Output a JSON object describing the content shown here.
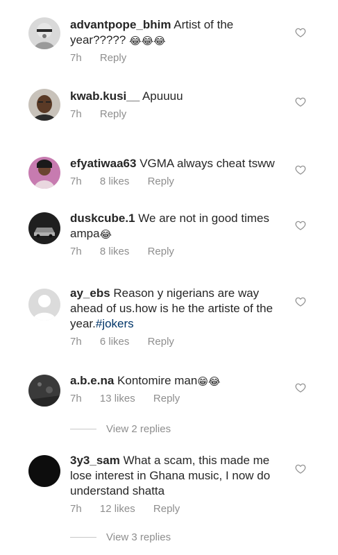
{
  "comments": [
    {
      "username": "advantpope_bhim",
      "text": "Artist of the year?????",
      "emoji": "😂😂😂",
      "time": "7h",
      "likes": "",
      "reply_label": "Reply"
    },
    {
      "username": "kwab.kusi__",
      "text": "Apuuuu",
      "time": "7h",
      "likes": "",
      "reply_label": "Reply"
    },
    {
      "username": "efyatiwaa63",
      "text": "VGMA always cheat tsww",
      "time": "7h",
      "likes": "8 likes",
      "reply_label": "Reply"
    },
    {
      "username": "duskcube.1",
      "text": "We are not in good times ampa",
      "emoji": "😂",
      "time": "7h",
      "likes": "8 likes",
      "reply_label": "Reply"
    },
    {
      "username": "ay_ebs",
      "text": "Reason y nigerians are way ahead of us.how is he the artiste of the year.",
      "hashtag": "#jokers",
      "time": "7h",
      "likes": "6 likes",
      "reply_label": "Reply"
    },
    {
      "username": "a.b.e.na",
      "text": "Kontomire man",
      "emoji": "😁😂",
      "time": "7h",
      "likes": "13 likes",
      "reply_label": "Reply",
      "view_replies": "View 2 replies"
    },
    {
      "username": "3y3_sam",
      "text": "What a scam, this made me lose interest in Ghana music, I now do understand shatta",
      "time": "7h",
      "likes": "12 likes",
      "reply_label": "Reply",
      "view_replies": "View 3 replies"
    }
  ],
  "icons": {
    "like": "heart-outline-icon",
    "avatar_placeholder": "default-avatar-icon"
  },
  "colors": {
    "text": "#262626",
    "secondary": "#8e8e8e",
    "hashtag": "#003569",
    "divider": "#c7c7c7"
  }
}
